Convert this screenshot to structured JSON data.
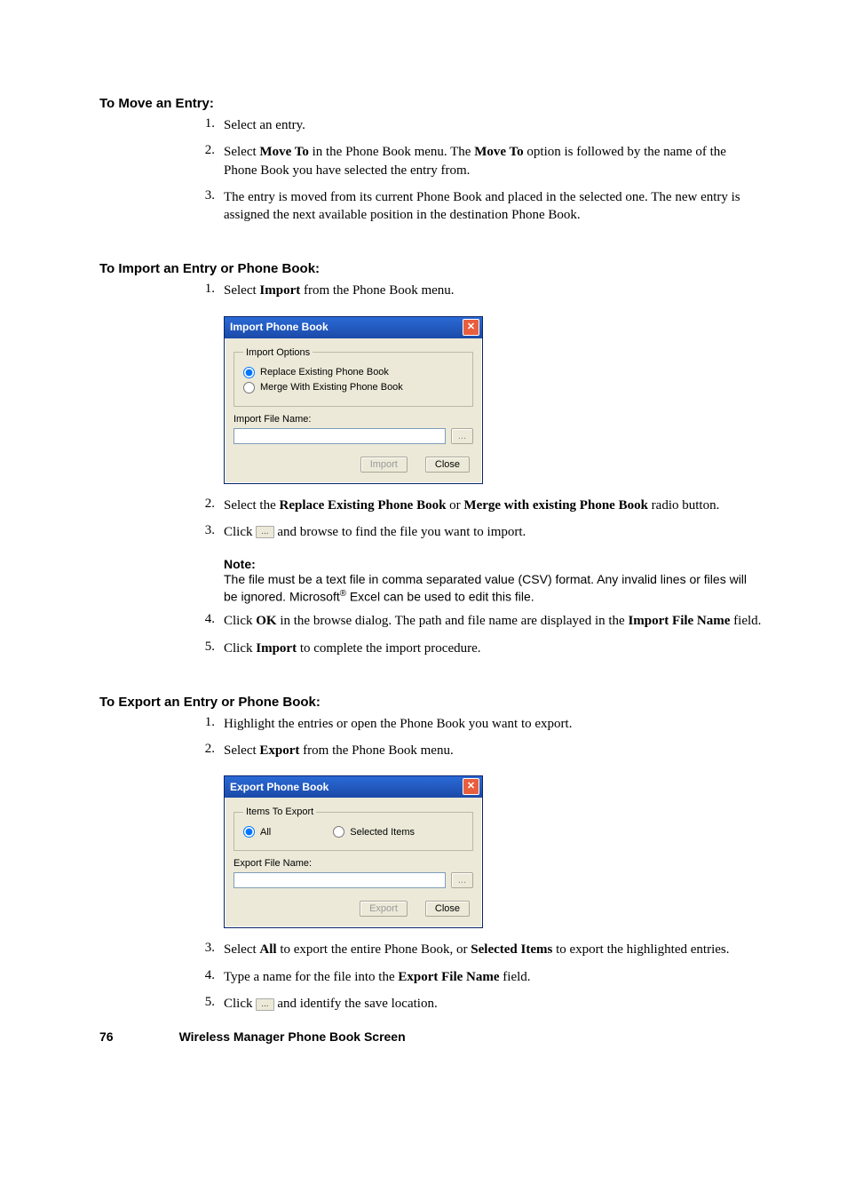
{
  "headings": {
    "move": "To Move an Entry:",
    "import": "To Import an Entry or Phone Book:",
    "export": "To Export an Entry or Phone Book:"
  },
  "move_steps": {
    "n1": "1.",
    "t1": "Select an entry.",
    "n2": "2.",
    "t2a": "Select ",
    "t2b": "Move To",
    "t2c": " in the Phone Book menu. The ",
    "t2d": "Move To",
    "t2e": " option is followed by the name of the Phone Book you have selected the entry from.",
    "n3": "3.",
    "t3": "The entry is moved from its current Phone Book and placed in the selected one. The new entry is assigned the next available position in the destination Phone Book."
  },
  "import_steps": {
    "n1": "1.",
    "t1a": "Select ",
    "t1b": "Import",
    "t1c": " from the Phone Book menu.",
    "n2": "2.",
    "t2a": "Select the ",
    "t2b": "Replace Existing Phone Book",
    "t2c": " or ",
    "t2d": "Merge with existing Phone Book",
    "t2e": " radio button.",
    "n3": "3.",
    "t3a": "Click ",
    "t3b": "...",
    "t3c": " and browse to find the file you want to import.",
    "n4": "4.",
    "t4a": "Click ",
    "t4b": "OK",
    "t4c": " in the browse dialog. The path and file name are displayed in the ",
    "t4d": "Import File Name",
    "t4e": " field.",
    "n5": "5.",
    "t5a": "Click ",
    "t5b": "Import",
    "t5c": " to complete the import procedure."
  },
  "note": {
    "title": "Note:",
    "l1": "The file must be a text file in comma separated value (CSV) format. Any invalid lines or files will be ignored. Microsoft",
    "reg": "®",
    "l2": " Excel can be used to edit this file."
  },
  "export_steps": {
    "n1": "1.",
    "t1": "Highlight the entries or open the Phone Book you want to export.",
    "n2": "2.",
    "t2a": "Select ",
    "t2b": "Export",
    "t2c": " from the Phone Book menu.",
    "n3": "3.",
    "t3a": "Select ",
    "t3b": "All",
    "t3c": " to export the entire Phone Book, or ",
    "t3d": "Selected Items",
    "t3e": " to export the highlighted entries.",
    "n4": "4.",
    "t4a": "Type a name for the file into the ",
    "t4b": "Export File Name",
    "t4c": " field.",
    "n5": "5.",
    "t5a": "Click ",
    "t5b": "...",
    "t5c": " and identify the save location."
  },
  "import_dialog": {
    "title": "Import Phone Book",
    "group": "Import Options",
    "opt1": "Replace Existing Phone Book",
    "opt2": "Merge With Existing Phone Book",
    "file_label": "Import File Name:",
    "browse": "...",
    "importBtn": "Import",
    "closeBtn": "Close"
  },
  "export_dialog": {
    "title": "Export Phone Book",
    "group": "Items To Export",
    "opt1": "All",
    "opt2": "Selected Items",
    "file_label": "Export File Name:",
    "browse": "...",
    "exportBtn": "Export",
    "closeBtn": "Close"
  },
  "footer": {
    "page": "76",
    "title": "Wireless Manager Phone Book Screen"
  }
}
